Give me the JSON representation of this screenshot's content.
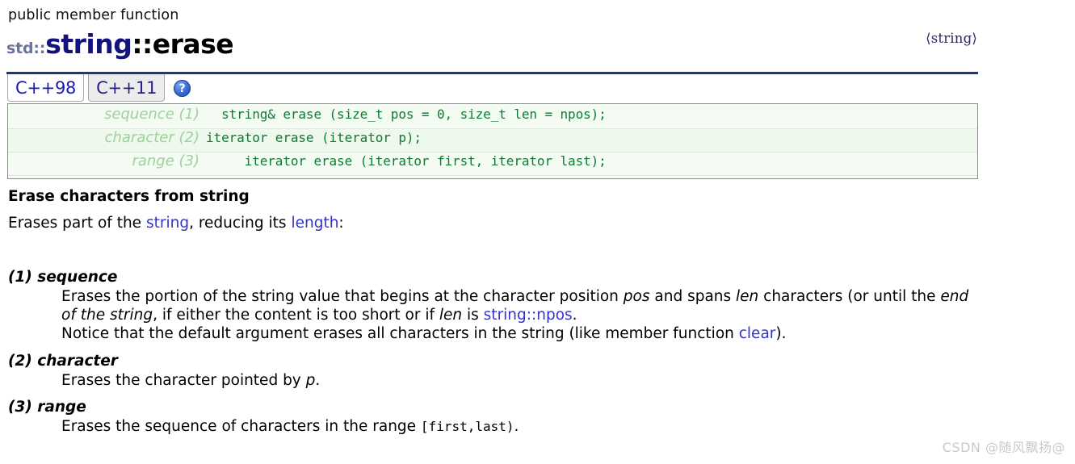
{
  "header": {
    "kicker": "public member function",
    "namespace": "std::",
    "class_name": "string",
    "member_name": "::erase",
    "include_header": "⟨string⟩"
  },
  "tabs": {
    "items": [
      {
        "label": "C++98",
        "active": true
      },
      {
        "label": "C++11",
        "active": false
      }
    ],
    "help_glyph": "?"
  },
  "signatures": {
    "rows": [
      {
        "label": "sequence (1)",
        "code": "  string& erase (size_t pos = 0, size_t len = npos);"
      },
      {
        "label": "character (2)",
        "code": "iterator erase (iterator p);"
      },
      {
        "label": "range (3)",
        "code": "     iterator erase (iterator first, iterator last);"
      }
    ]
  },
  "body": {
    "section_title": "Erase characters from string",
    "lead": {
      "part1": "Erases part of the ",
      "link1": "string",
      "part2": ", reducing its ",
      "link2": "length",
      "part3": ":"
    },
    "variants": [
      {
        "heading": "(1) sequence",
        "lines": [
          {
            "segments": [
              {
                "text": "Erases the portion of the string value that begins at the character position "
              },
              {
                "text": "pos",
                "style": "italic"
              },
              {
                "text": " and spans "
              },
              {
                "text": "len",
                "style": "italic"
              },
              {
                "text": " characters (or until the "
              },
              {
                "text": "end of the string",
                "style": "italic"
              },
              {
                "text": ", if either the content is too short or if "
              },
              {
                "text": "len",
                "style": "italic"
              },
              {
                "text": " is "
              },
              {
                "text": "string::npos",
                "style": "link"
              },
              {
                "text": "."
              }
            ]
          },
          {
            "segments": [
              {
                "text": "Notice that the default argument erases all characters in the string (like member function "
              },
              {
                "text": "clear",
                "style": "link"
              },
              {
                "text": ")."
              }
            ]
          }
        ]
      },
      {
        "heading": "(2) character",
        "lines": [
          {
            "segments": [
              {
                "text": "Erases the character pointed by "
              },
              {
                "text": "p",
                "style": "italic"
              },
              {
                "text": "."
              }
            ]
          }
        ]
      },
      {
        "heading": "(3) range",
        "lines": [
          {
            "segments": [
              {
                "text": "Erases the sequence of characters in the range "
              },
              {
                "text": "[first,last)",
                "style": "mono"
              },
              {
                "text": "."
              }
            ]
          }
        ]
      }
    ]
  },
  "watermark": {
    "text": "CSDN @随风飘扬@"
  },
  "colors": {
    "title_class": "#13137e",
    "title_namespace": "#6a74a0",
    "rule": "#1a3a78",
    "link": "#3333cc",
    "sig_code": "#0e7a32",
    "sig_label": "#9ed19b",
    "sig_bg": "#f4fbf3",
    "watermark": "#c9c9c9"
  }
}
